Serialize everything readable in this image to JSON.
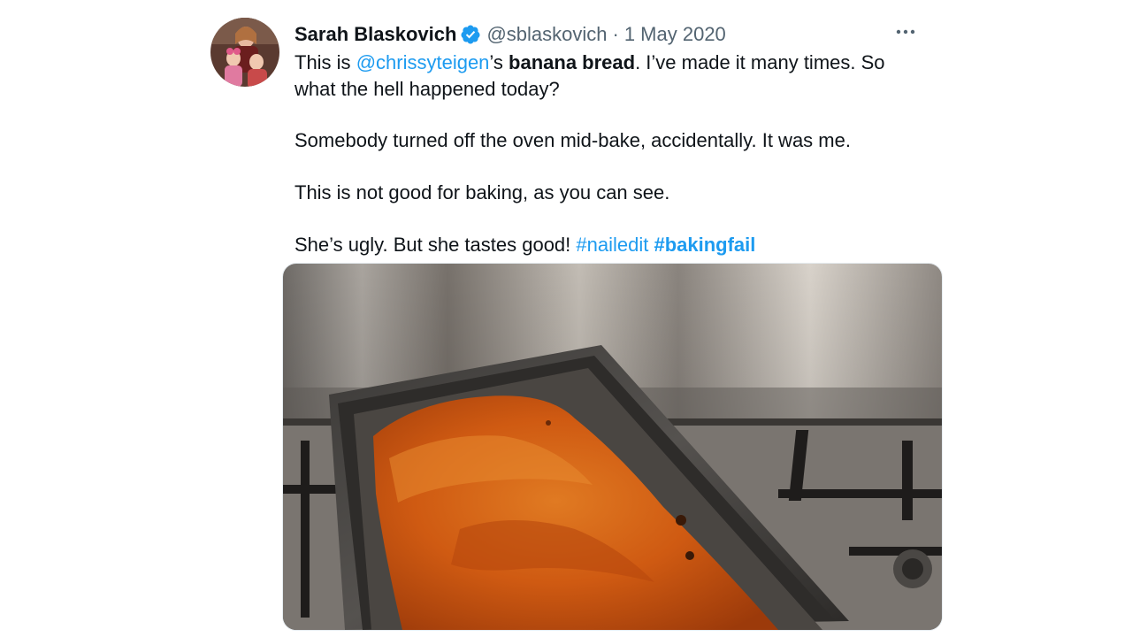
{
  "tweet": {
    "author": {
      "name": "Sarah Blaskovich",
      "handle": "@sblaskovich",
      "verified": true,
      "avatar_icon": "profile-photo"
    },
    "separator": "·",
    "date": "1 May 2020",
    "more_icon": "more-horizontal-icon",
    "text": {
      "p1_prefix": "This is ",
      "p1_mention": "@chrissyteigen",
      "p1_possessive": "’s ",
      "p1_bold": "banana bread",
      "p1_rest": ". I’ve made it many times. So",
      "p1_line2": "what the hell happened today?",
      "p2": "Somebody turned off the oven mid-bake, accidentally. It was me.",
      "p3": "This is not good for baking, as you can see.",
      "p4_text": "She’s ugly. But she tastes good! ",
      "hashtag1": "#nailedit",
      "hashtag2": "#bakingfail"
    },
    "media_icon": "photo-banana-bread-in-loaf-pan",
    "colors": {
      "link": "#1d9bf0",
      "verified": "#1d9bf0",
      "secondary_text": "#536471"
    }
  }
}
